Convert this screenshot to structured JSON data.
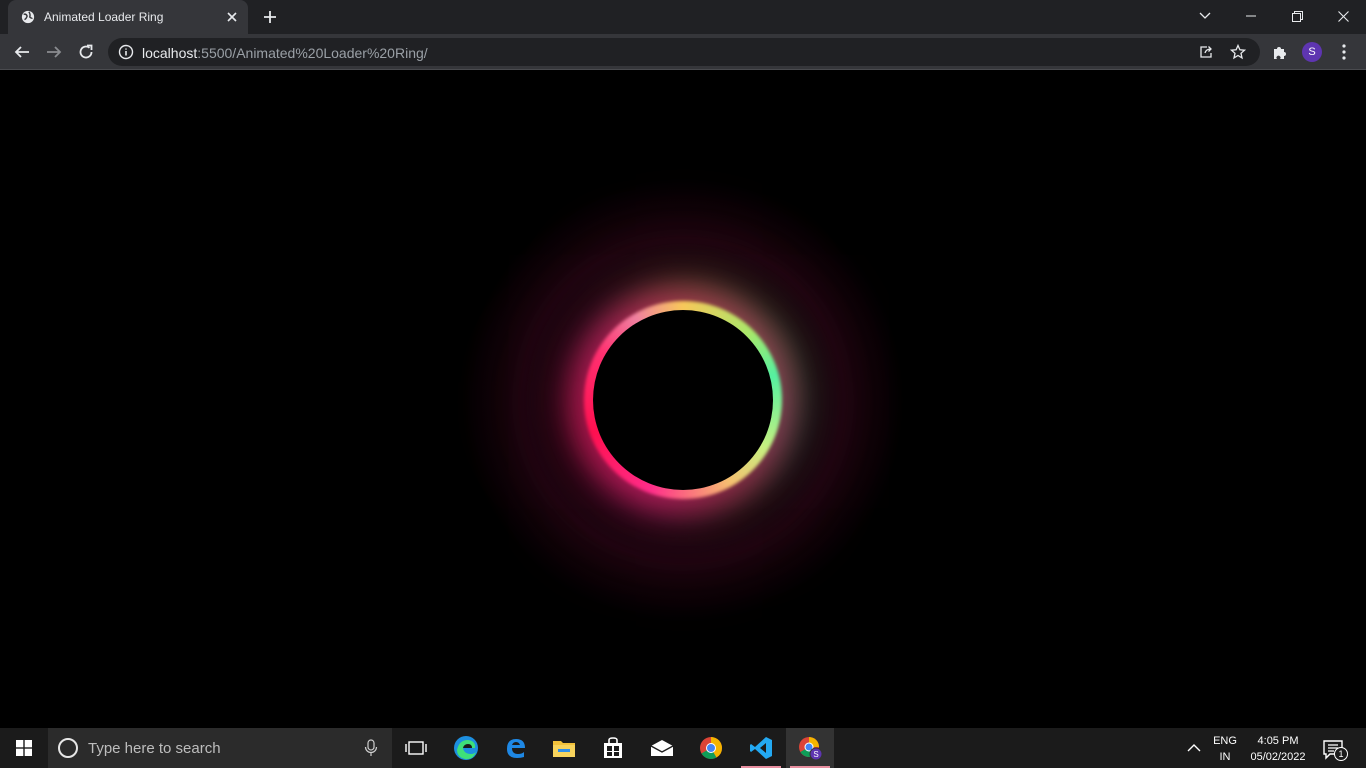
{
  "browser": {
    "tab": {
      "title": "Animated Loader Ring"
    },
    "address": {
      "host": "localhost",
      "path": ":5500/Animated%20Loader%20Ring/"
    },
    "profile_initial": "S"
  },
  "page": {
    "ring_colors": [
      "#f8c85a",
      "#55f0a0",
      "#ff2d8a",
      "#ff1050"
    ],
    "background": "#000000"
  },
  "taskbar": {
    "search_placeholder": "Type here to search",
    "apps": [
      "task-view-icon",
      "edge-icon",
      "edge-legacy-icon",
      "file-explorer-icon",
      "store-icon",
      "mail-icon",
      "chrome-icon",
      "vscode-icon",
      "chrome-profile-icon"
    ],
    "language": {
      "line1": "ENG",
      "line2": "IN"
    },
    "clock": {
      "time": "4:05 PM",
      "date": "05/02/2022"
    },
    "notification_count": "1"
  }
}
